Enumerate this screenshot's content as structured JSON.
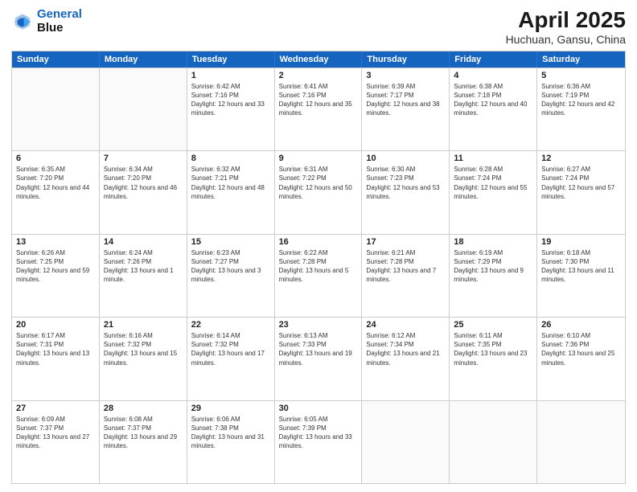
{
  "logo": {
    "line1": "General",
    "line2": "Blue"
  },
  "title": "April 2025",
  "subtitle": "Huchuan, Gansu, China",
  "weekdays": [
    "Sunday",
    "Monday",
    "Tuesday",
    "Wednesday",
    "Thursday",
    "Friday",
    "Saturday"
  ],
  "rows": [
    [
      {
        "day": "",
        "info": ""
      },
      {
        "day": "",
        "info": ""
      },
      {
        "day": "1",
        "info": "Sunrise: 6:42 AM\nSunset: 7:16 PM\nDaylight: 12 hours and 33 minutes."
      },
      {
        "day": "2",
        "info": "Sunrise: 6:41 AM\nSunset: 7:16 PM\nDaylight: 12 hours and 35 minutes."
      },
      {
        "day": "3",
        "info": "Sunrise: 6:39 AM\nSunset: 7:17 PM\nDaylight: 12 hours and 38 minutes."
      },
      {
        "day": "4",
        "info": "Sunrise: 6:38 AM\nSunset: 7:18 PM\nDaylight: 12 hours and 40 minutes."
      },
      {
        "day": "5",
        "info": "Sunrise: 6:36 AM\nSunset: 7:19 PM\nDaylight: 12 hours and 42 minutes."
      }
    ],
    [
      {
        "day": "6",
        "info": "Sunrise: 6:35 AM\nSunset: 7:20 PM\nDaylight: 12 hours and 44 minutes."
      },
      {
        "day": "7",
        "info": "Sunrise: 6:34 AM\nSunset: 7:20 PM\nDaylight: 12 hours and 46 minutes."
      },
      {
        "day": "8",
        "info": "Sunrise: 6:32 AM\nSunset: 7:21 PM\nDaylight: 12 hours and 48 minutes."
      },
      {
        "day": "9",
        "info": "Sunrise: 6:31 AM\nSunset: 7:22 PM\nDaylight: 12 hours and 50 minutes."
      },
      {
        "day": "10",
        "info": "Sunrise: 6:30 AM\nSunset: 7:23 PM\nDaylight: 12 hours and 53 minutes."
      },
      {
        "day": "11",
        "info": "Sunrise: 6:28 AM\nSunset: 7:24 PM\nDaylight: 12 hours and 55 minutes."
      },
      {
        "day": "12",
        "info": "Sunrise: 6:27 AM\nSunset: 7:24 PM\nDaylight: 12 hours and 57 minutes."
      }
    ],
    [
      {
        "day": "13",
        "info": "Sunrise: 6:26 AM\nSunset: 7:25 PM\nDaylight: 12 hours and 59 minutes."
      },
      {
        "day": "14",
        "info": "Sunrise: 6:24 AM\nSunset: 7:26 PM\nDaylight: 13 hours and 1 minute."
      },
      {
        "day": "15",
        "info": "Sunrise: 6:23 AM\nSunset: 7:27 PM\nDaylight: 13 hours and 3 minutes."
      },
      {
        "day": "16",
        "info": "Sunrise: 6:22 AM\nSunset: 7:28 PM\nDaylight: 13 hours and 5 minutes."
      },
      {
        "day": "17",
        "info": "Sunrise: 6:21 AM\nSunset: 7:28 PM\nDaylight: 13 hours and 7 minutes."
      },
      {
        "day": "18",
        "info": "Sunrise: 6:19 AM\nSunset: 7:29 PM\nDaylight: 13 hours and 9 minutes."
      },
      {
        "day": "19",
        "info": "Sunrise: 6:18 AM\nSunset: 7:30 PM\nDaylight: 13 hours and 11 minutes."
      }
    ],
    [
      {
        "day": "20",
        "info": "Sunrise: 6:17 AM\nSunset: 7:31 PM\nDaylight: 13 hours and 13 minutes."
      },
      {
        "day": "21",
        "info": "Sunrise: 6:16 AM\nSunset: 7:32 PM\nDaylight: 13 hours and 15 minutes."
      },
      {
        "day": "22",
        "info": "Sunrise: 6:14 AM\nSunset: 7:32 PM\nDaylight: 13 hours and 17 minutes."
      },
      {
        "day": "23",
        "info": "Sunrise: 6:13 AM\nSunset: 7:33 PM\nDaylight: 13 hours and 19 minutes."
      },
      {
        "day": "24",
        "info": "Sunrise: 6:12 AM\nSunset: 7:34 PM\nDaylight: 13 hours and 21 minutes."
      },
      {
        "day": "25",
        "info": "Sunrise: 6:11 AM\nSunset: 7:35 PM\nDaylight: 13 hours and 23 minutes."
      },
      {
        "day": "26",
        "info": "Sunrise: 6:10 AM\nSunset: 7:36 PM\nDaylight: 13 hours and 25 minutes."
      }
    ],
    [
      {
        "day": "27",
        "info": "Sunrise: 6:09 AM\nSunset: 7:37 PM\nDaylight: 13 hours and 27 minutes."
      },
      {
        "day": "28",
        "info": "Sunrise: 6:08 AM\nSunset: 7:37 PM\nDaylight: 13 hours and 29 minutes."
      },
      {
        "day": "29",
        "info": "Sunrise: 6:06 AM\nSunset: 7:38 PM\nDaylight: 13 hours and 31 minutes."
      },
      {
        "day": "30",
        "info": "Sunrise: 6:05 AM\nSunset: 7:39 PM\nDaylight: 13 hours and 33 minutes."
      },
      {
        "day": "",
        "info": ""
      },
      {
        "day": "",
        "info": ""
      },
      {
        "day": "",
        "info": ""
      }
    ]
  ]
}
